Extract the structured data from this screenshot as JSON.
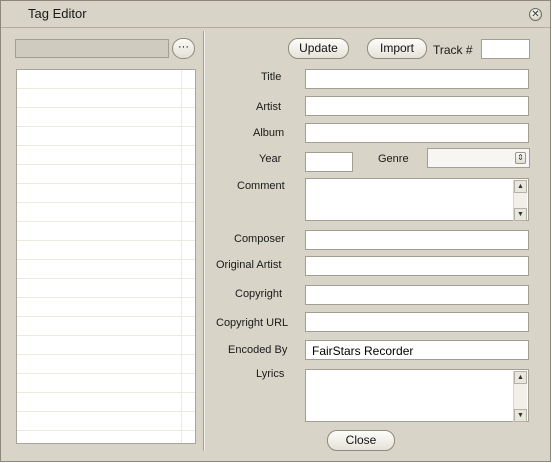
{
  "window": {
    "title": "Tag Editor"
  },
  "icons": {
    "close": "close-icon",
    "browse": "ellipsis-icon"
  },
  "sidebar": {
    "path_value": "",
    "browse_label": "···"
  },
  "toolbar": {
    "update_label": "Update",
    "import_label": "Import",
    "track_label": "Track #",
    "track_value": ""
  },
  "fields": {
    "title": {
      "label": "Title",
      "value": ""
    },
    "artist": {
      "label": "Artist",
      "value": ""
    },
    "album": {
      "label": "Album",
      "value": ""
    },
    "year": {
      "label": "Year",
      "value": ""
    },
    "genre": {
      "label": "Genre",
      "value": ""
    },
    "comment": {
      "label": "Comment",
      "value": ""
    },
    "composer": {
      "label": "Composer",
      "value": ""
    },
    "original_artist": {
      "label": "Original Artist",
      "value": ""
    },
    "copyright": {
      "label": "Copyright",
      "value": ""
    },
    "copyright_url": {
      "label": "Copyright URL",
      "value": ""
    },
    "encoded_by": {
      "label": "Encoded By",
      "value": "FairStars Recorder"
    },
    "lyrics": {
      "label": "Lyrics",
      "value": ""
    }
  },
  "footer": {
    "close_label": "Close"
  }
}
